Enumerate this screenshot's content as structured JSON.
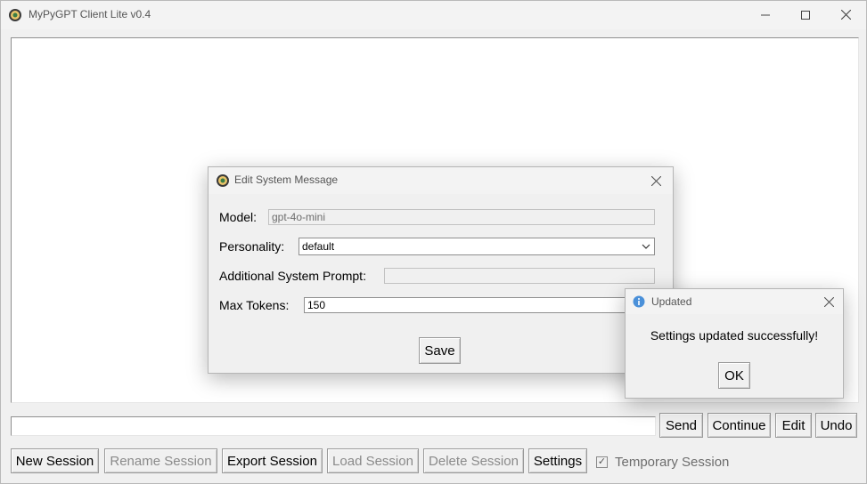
{
  "window": {
    "title": "MyPyGPT Client Lite v0.4",
    "controls": [
      "minimize",
      "maximize",
      "close"
    ]
  },
  "input_row": {
    "message_value": "",
    "buttons": {
      "send": "Send",
      "continue": "Continue",
      "edit": "Edit",
      "undo": "Undo"
    }
  },
  "bottom_bar": {
    "new_session": "New Session",
    "rename_session": "Rename Session",
    "export_session": "Export Session",
    "load_session": "Load Session",
    "delete_session": "Delete Session",
    "settings": "Settings",
    "temporary_session": {
      "label": "Temporary Session",
      "checked": true
    }
  },
  "dialog": {
    "title": "Edit System Message",
    "model_label": "Model:",
    "model_value": "gpt-4o-mini",
    "personality_label": "Personality:",
    "personality_value": "default",
    "additional_prompt_label": "Additional System Prompt:",
    "additional_prompt_value": "",
    "max_tokens_label": "Max Tokens:",
    "max_tokens_value": "150",
    "save_label": "Save"
  },
  "messagebox": {
    "title": "Updated",
    "message": "Settings updated successfully!",
    "ok_label": "OK",
    "icon": "info-icon"
  },
  "colors": {
    "window_bg": "#f0f0f0",
    "titlebar_bg": "#f3f3f3",
    "info_blue": "#4a90d9"
  }
}
